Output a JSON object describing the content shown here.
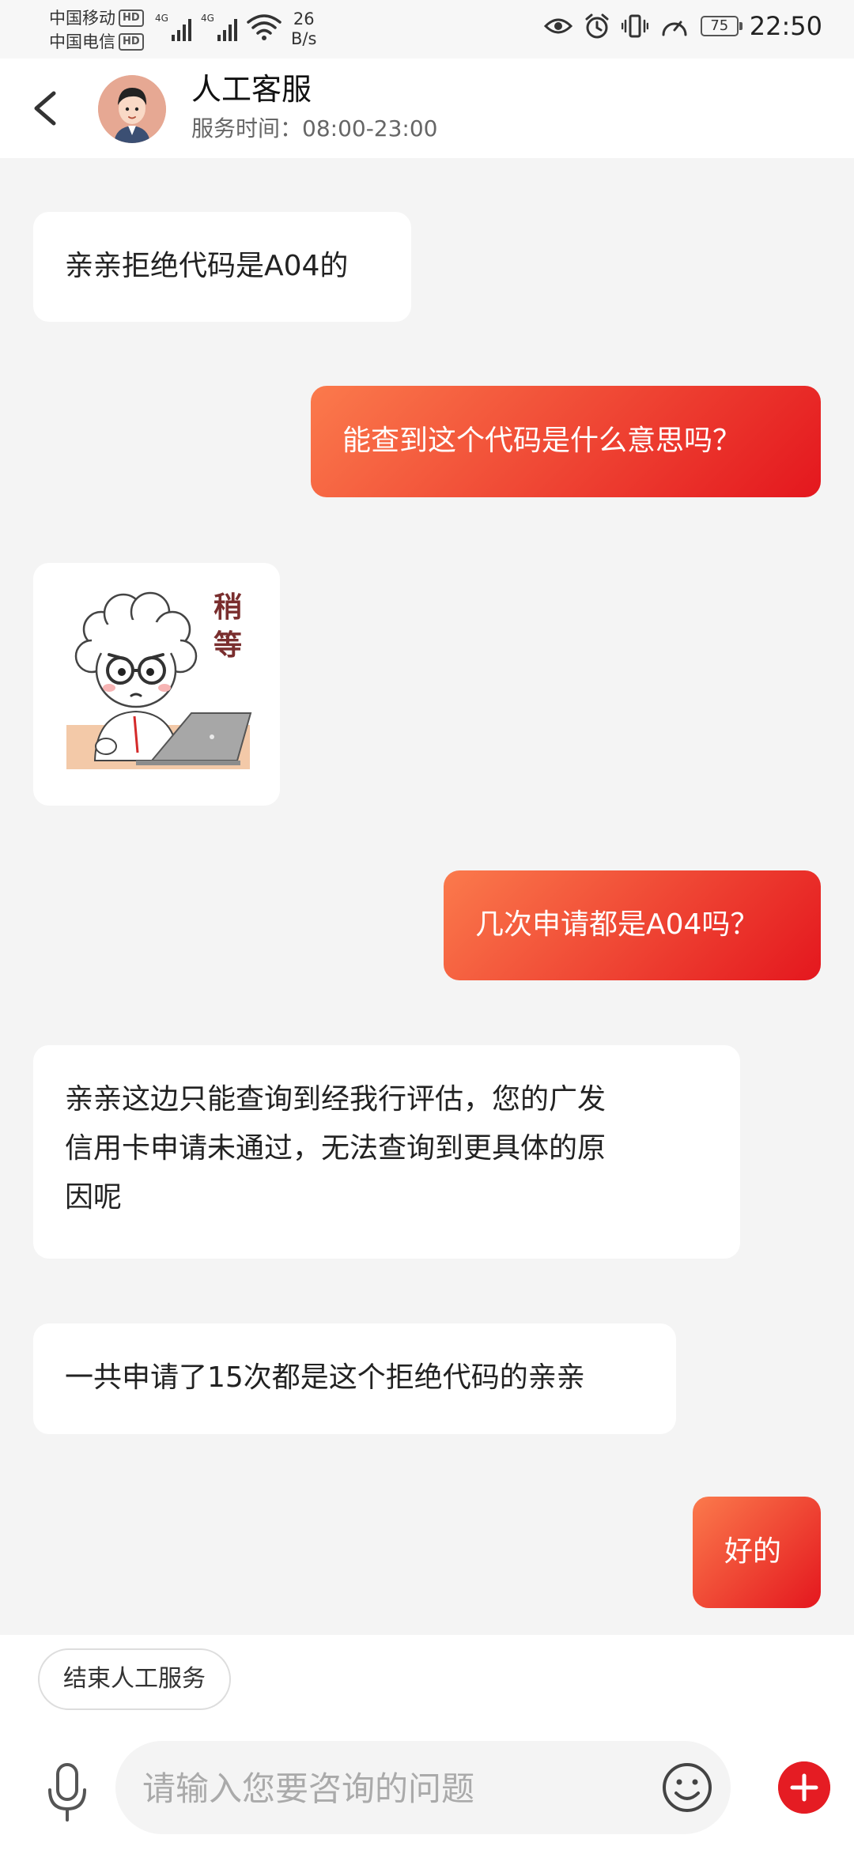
{
  "status_bar": {
    "carrier1": "中国移动",
    "carrier2": "中国电信",
    "hd": "HD",
    "net1": "4G",
    "net2": "4G",
    "speed_value": "26",
    "speed_unit": "B/s",
    "battery": "75",
    "time": "22:50",
    "icons": [
      "eye-icon",
      "alarm-icon",
      "vibrate-icon",
      "speedometer-icon"
    ]
  },
  "header": {
    "title": "人工客服",
    "subtitle": "服务时间：08:00-23:00"
  },
  "messages": [
    {
      "side": "left",
      "text": "亲亲拒绝代码是A04的"
    },
    {
      "side": "right",
      "text": "能查到这个代码是什么意思吗？"
    },
    {
      "side": "left",
      "type": "sticker",
      "sticker_text": "稍等"
    },
    {
      "side": "right",
      "text": "几次申请都是A04吗？"
    },
    {
      "side": "left",
      "lines": [
        "亲亲这边只能查询到经我行评估，您的广发",
        "信用卡申请未通过，无法查询到更具体的原",
        "因呢"
      ]
    },
    {
      "side": "left",
      "text": "一共申请了15次都是这个拒绝代码的亲亲"
    },
    {
      "side": "right",
      "text": "好的"
    }
  ],
  "bottom": {
    "end_service_label": "结束人工服务",
    "input_placeholder": "请输入您要咨询的问题",
    "input_value": ""
  },
  "colors": {
    "bubble_right_start": "#fb7a4c",
    "bubble_right_end": "#e4171e",
    "plus_button": "#e51c23",
    "background": "#f4f4f4"
  }
}
